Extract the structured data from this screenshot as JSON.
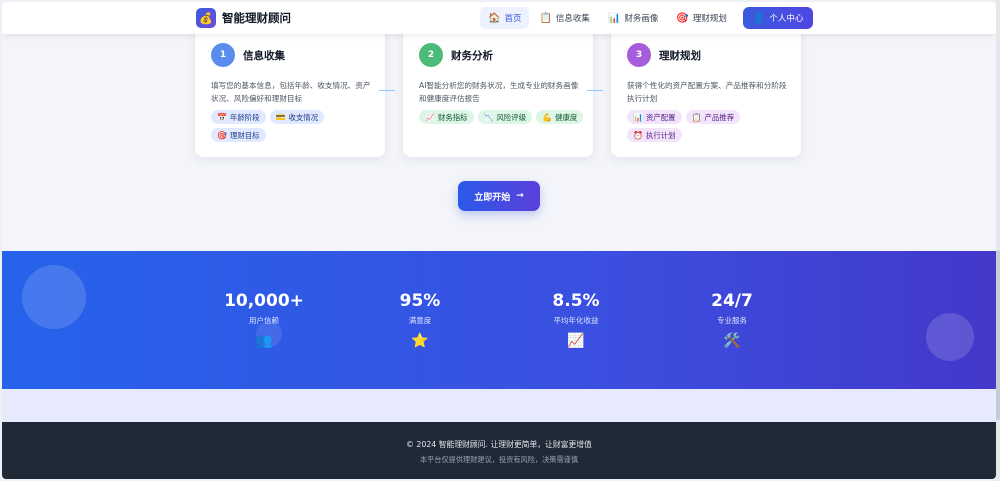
{
  "header": {
    "logo_icon": "💰",
    "title": "智能理财顾问",
    "nav": [
      {
        "icon": "🏠",
        "label": "首页"
      },
      {
        "icon": "📋",
        "label": "信息收集"
      },
      {
        "icon": "📊",
        "label": "财务画像"
      },
      {
        "icon": "🎯",
        "label": "理财规划"
      }
    ],
    "cta": {
      "icon": "👤",
      "label": "个人中心"
    }
  },
  "steps": [
    {
      "num": "1",
      "title": "信息收集",
      "color": "#5b8def",
      "desc": "填写您的基本信息，包括年龄、收支情况、资产状况、风险偏好和理财目标",
      "tags": [
        {
          "icon": "📅",
          "label": "年龄阶段"
        },
        {
          "icon": "💳",
          "label": "收支情况"
        },
        {
          "icon": "🎯",
          "label": "理财目标"
        }
      ]
    },
    {
      "num": "2",
      "title": "财务分析",
      "color": "#4cbb7a",
      "desc": "AI智能分析您的财务状况，生成专业的财务画像和健康度评估报告",
      "tags": [
        {
          "icon": "📈",
          "label": "财务指标"
        },
        {
          "icon": "📉",
          "label": "风险评级"
        },
        {
          "icon": "💪",
          "label": "健康度"
        }
      ]
    },
    {
      "num": "3",
      "title": "理财规划",
      "color": "#a65ddc",
      "desc": "获得个性化的资产配置方案、产品推荐和分阶段执行计划",
      "tags": [
        {
          "icon": "📊",
          "label": "资产配置"
        },
        {
          "icon": "📋",
          "label": "产品推荐"
        },
        {
          "icon": "⏰",
          "label": "执行计划"
        }
      ]
    }
  ],
  "start": {
    "label": "立即开始",
    "arrow": "→"
  },
  "stats": [
    {
      "value": "10,000+",
      "label": "用户信赖",
      "icon": "👥"
    },
    {
      "value": "95%",
      "label": "满意度",
      "icon": "⭐"
    },
    {
      "value": "8.5%",
      "label": "平均年化收益",
      "icon": "📈"
    },
    {
      "value": "24/7",
      "label": "专业服务",
      "icon": "🛠️"
    }
  ],
  "footer": {
    "line1": "© 2024 智能理财顾问. 让理财更简单，让财富更增值",
    "line2": "本平台仅提供理财建议，投资有风险，决策需谨慎"
  }
}
